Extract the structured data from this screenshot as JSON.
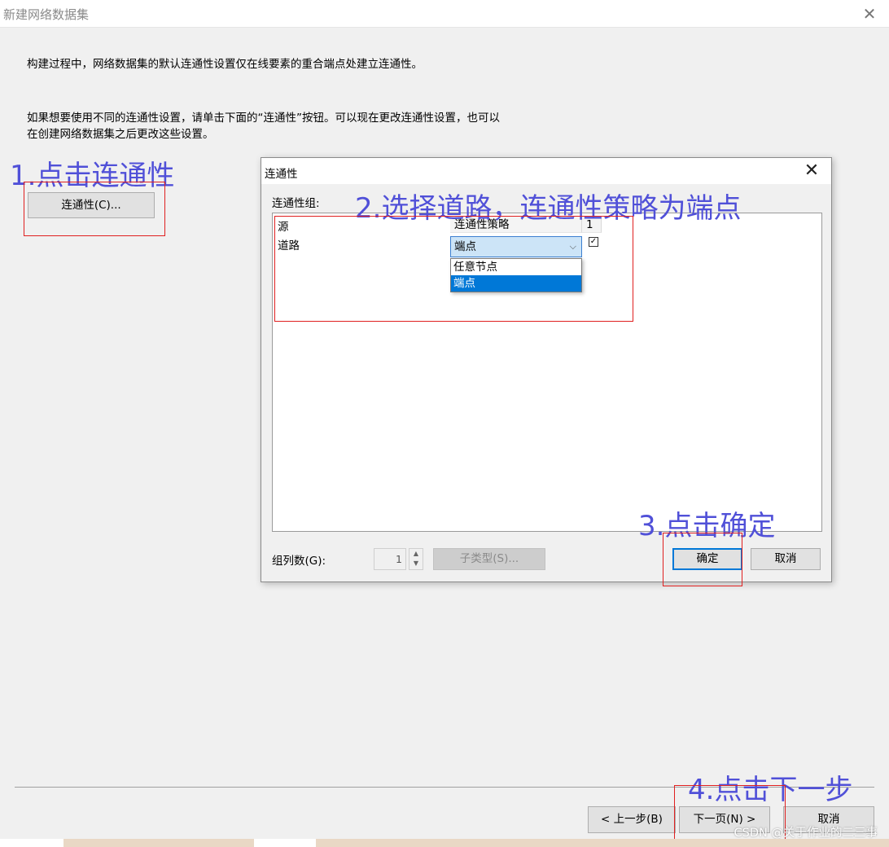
{
  "window": {
    "title": "新建网络数据集",
    "close_glyph": "✕"
  },
  "text": {
    "desc1": "构建过程中，网络数据集的默认连通性设置仅在线要素的重合端点处建立连通性。",
    "desc2": "如果想要使用不同的连通性设置，请单击下面的“连通性”按钮。可以现在更改连通性设置，也可以在创建网络数据集之后更改这些设置。"
  },
  "buttons": {
    "connectivity": "连通性(C)...",
    "prev": "< 上一步(B)",
    "next": "下一页(N) >",
    "cancel": "取消"
  },
  "annotations": {
    "step1": "1.点击连通性",
    "step2": "2.选择道路，连通性策略为端点",
    "step3": "3.点击确定",
    "step4": "4.点击下一步"
  },
  "dialog": {
    "title": "连通性",
    "close_glyph": "✕",
    "group_label": "连通性组:",
    "grid": {
      "row_headers": [
        "源",
        "道路"
      ],
      "col_header_policy": "连通性策略",
      "col_header_group": "1",
      "selected_policy": "端点",
      "combo_arrow": "⌵",
      "options": [
        "任意节点",
        "端点"
      ],
      "checked_mark": "✓"
    },
    "group_count_label": "组列数(G):",
    "group_count_value": "1",
    "spin_up": "▲",
    "spin_down": "▼",
    "subtype_button": "子类型(S)...",
    "ok_button": "确定",
    "cancel_button": "取消"
  },
  "watermark": "CSDN @关于作业的二三事",
  "colors": {
    "annotation_text": "#5050d8",
    "annotation_box": "#e02020",
    "selection": "#0078d7"
  }
}
